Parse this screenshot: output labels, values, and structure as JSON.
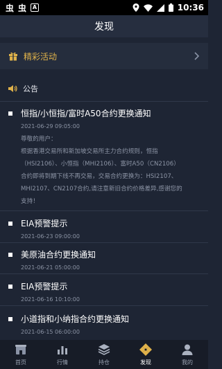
{
  "status_bar": {
    "time": "10:36",
    "app_icons": [
      "虫",
      "虫"
    ],
    "badge": "A"
  },
  "header": {
    "title": "发现"
  },
  "featured": {
    "label": "精彩活动"
  },
  "announcements": {
    "label": "公告",
    "items": [
      {
        "title": "恒指/小恒指/富时A50合约更换通知",
        "date": "2021-06-29 09:05:00",
        "body_lines": [
          "尊敬的用户：",
          "根据香港交易所和新加坡交易所主力合约规则，恒指",
          "（HSI2106）、小恒指（MHI2106）、富时A50（CN2106）",
          "合约即将到期下线不再交易，交易合约更换为：HSI2107、",
          "MHI2107、CN2107合约,请注意新旧合约价格差异,感谢您的",
          "支持！"
        ]
      },
      {
        "title": "EIA预警提示",
        "date": "2021-06-23 09:00:00"
      },
      {
        "title": "美原油合约更换通知",
        "date": "2021-06-21 05:00:00"
      },
      {
        "title": "EIA预警提示",
        "date": "2021-06-16 10:10:00"
      },
      {
        "title": "小道指和小纳指合约更换通知",
        "date": "2021-06-15 06:00:00"
      }
    ]
  },
  "tabs": [
    {
      "label": "首页",
      "icon": "home-icon"
    },
    {
      "label": "行情",
      "icon": "bar-chart-icon"
    },
    {
      "label": "持仓",
      "icon": "layers-icon"
    },
    {
      "label": "发现",
      "icon": "discover-icon",
      "active": true
    },
    {
      "label": "我的",
      "icon": "user-icon"
    }
  ],
  "colors": {
    "background": "#1e2534",
    "accent": "#e0b24a",
    "secondary_text": "#8c94a5"
  }
}
